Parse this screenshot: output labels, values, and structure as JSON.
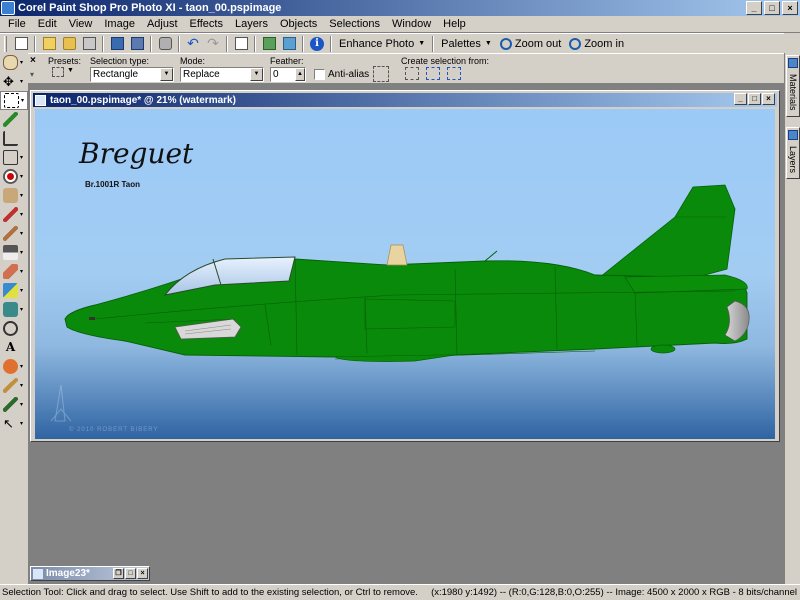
{
  "window": {
    "title": "Corel Paint Shop Pro Photo XI - taon_00.pspimage",
    "controls": [
      "_",
      "□",
      "×"
    ]
  },
  "menu": [
    "File",
    "Edit",
    "View",
    "Image",
    "Adjust",
    "Effects",
    "Layers",
    "Objects",
    "Selections",
    "Window",
    "Help"
  ],
  "toolbar": {
    "enhance_photo": "Enhance Photo",
    "palettes": "Palettes",
    "zoom_out": "Zoom out",
    "zoom_in": "Zoom in"
  },
  "tool_options": {
    "presets_label": "Presets:",
    "selection_type_label": "Selection type:",
    "selection_type_value": "Rectangle",
    "mode_label": "Mode:",
    "mode_value": "Replace",
    "feather_label": "Feather:",
    "feather_value": "0",
    "anti_alias_label": "Anti-alias",
    "anti_alias_checked": false,
    "create_selection_label": "Create selection from:"
  },
  "document": {
    "title": "taon_00.pspimage* @  21% (watermark)",
    "heading": "Breguet",
    "subheading": "Br.1001R Taon",
    "watermark_text": "© 2010 ROBERT BIBERY",
    "aircraft_color": "#0a8a0a",
    "sky_top": "#a8d0f8",
    "sky_bottom": "#2f6aa8"
  },
  "minimized_doc": {
    "title": "Image23*"
  },
  "dock": {
    "materials": "Materials",
    "layers": "Layers"
  },
  "status": {
    "hint": "Selection Tool: Click and drag to select. Use Shift to add to the existing selection, or Ctrl to remove.",
    "info": "(x:1980 y:1492) -- (R:0,G:128,B:0,O:255) -- Image:  4500 x 2000 x RGB - 8 bits/channel"
  },
  "tools": [
    "pan-tool",
    "move-tool",
    "selection-tool",
    "dropper-tool",
    "crop-tool",
    "straighten-tool",
    "red-eye-tool",
    "clone-tool",
    "scratch-remover-tool",
    "makeover-tool",
    "paint-brush-tool",
    "lighten-darken-tool",
    "eraser-tool",
    "background-eraser-tool",
    "flood-fill-tool",
    "pen-tool",
    "text-tool",
    "preset-shape-tool",
    "warp-brush-tool",
    "object-selector-tool"
  ]
}
